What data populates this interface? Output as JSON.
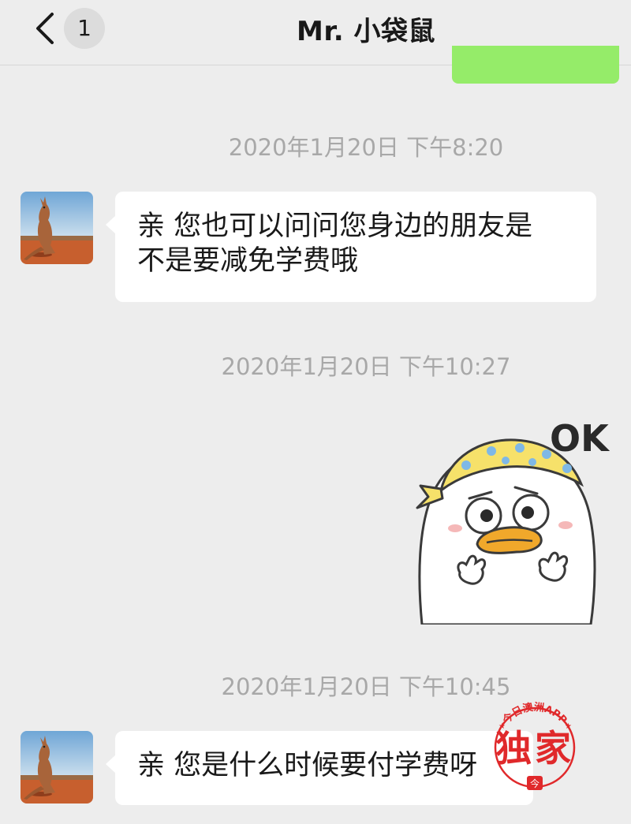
{
  "header": {
    "unread_count": "1",
    "title": "Mr. 小袋鼠"
  },
  "messages": {
    "time_1": "2020年1月20日 下午8:20",
    "msg_1_line_1": "亲 您也可以问问您身边的朋友是",
    "msg_1_line_2": "不是要减免学费哦",
    "time_2": "2020年1月20日 下午10:27",
    "sticker_text": "OK",
    "time_3": "2020年1月20日 下午10:45",
    "msg_2": "亲 您是什么时候要付学费呀"
  },
  "watermark": {
    "ring_text": "今日澳洲APP",
    "main_text": "独家",
    "small_mark": "今"
  },
  "colors": {
    "background": "#ededed",
    "sent_bubble": "#95ec69",
    "received_bubble": "#ffffff",
    "timestamp": "#a8a8a8",
    "watermark_red": "#e0292b"
  },
  "icons": [
    "chevron-left-icon",
    "kangaroo-avatar",
    "duck-ok-sticker",
    "watermark-stamp"
  ]
}
